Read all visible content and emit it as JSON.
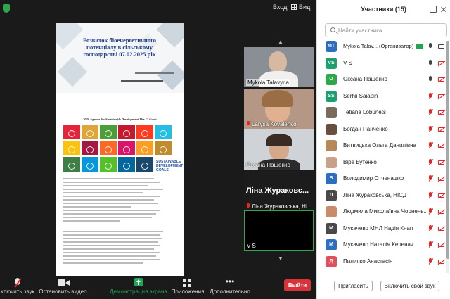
{
  "top": {
    "signin_label": "Вход",
    "view_label": "Вид"
  },
  "document": {
    "title": "Розвиток біоенергетичного потенціалу в сільському господарстві 07.02.2025 рік",
    "sdg_title": "2030 Agenda for Sustainable Development The 17 Goals",
    "goals_label": "SUSTAINABLE DEVELOPMENT GOALS",
    "sdg_colors": [
      "#e5243b",
      "#dda63a",
      "#4c9f38",
      "#c5192d",
      "#ff3a21",
      "#26bde2",
      "#fcc30b",
      "#a21942",
      "#fd6925",
      "#dd1367",
      "#fd9d24",
      "#bf8b2e",
      "#3f7e44",
      "#0a97d9",
      "#56c02b",
      "#00689d",
      "#19486a"
    ]
  },
  "videos": [
    {
      "name": "Mykola Talavyria",
      "muted": false
    },
    {
      "name": "Larysa Kovalenko",
      "muted": true
    },
    {
      "name": "Оксана Пащенко",
      "muted": false
    },
    {
      "name": "Ліна Жураковська, НІ...",
      "big_name": "Ліна Жураковс...",
      "muted": true
    },
    {
      "name": "V S",
      "muted": false
    }
  ],
  "toolbar": {
    "mute_label": "ключить звук",
    "video_label": "Остановить видео",
    "share_label": "Демонстрация экрана",
    "apps_label": "Приложения",
    "more_label": "Дополнительно",
    "leave_label": "Выйти",
    "share_color": "#23a455",
    "leave_color": "#d9333a"
  },
  "panel": {
    "title": "Участники (15)",
    "search_placeholder": "Найти участника",
    "invite_label": "Пригласить",
    "unmute_label": "Включить свой звук",
    "participants": [
      {
        "initials": "MT",
        "name": "Mykola Talav... (Организатор)",
        "color": "#2c6ebf",
        "mic": "on",
        "cam": "on",
        "sharing": true
      },
      {
        "initials": "VS",
        "name": "V S",
        "color": "#1f9e6e",
        "mic": "on",
        "cam": "off"
      },
      {
        "initials": "О",
        "name": "Оксана Пащенко",
        "color": "#2ea84a",
        "mic": "on",
        "cam": "off"
      },
      {
        "initials": "SS",
        "name": "Serhii Saiapin",
        "color": "#1f9e6e",
        "mic": "off",
        "cam": "off"
      },
      {
        "initials": "",
        "name": "Tetiana Lobunets",
        "color": "#7a6a5c",
        "mic": "off",
        "cam": "off"
      },
      {
        "initials": "",
        "name": "Богдан Панченко",
        "color": "#6b4f3e",
        "mic": "off",
        "cam": "off"
      },
      {
        "initials": "",
        "name": "Витвицька Ольга Данилівна",
        "color": "#b8875a",
        "mic": "off",
        "cam": "off"
      },
      {
        "initials": "",
        "name": "Віра Бутенко",
        "color": "#c9a08a",
        "mic": "off",
        "cam": "off"
      },
      {
        "initials": "В",
        "name": "Володимир Отченашко",
        "color": "#2c6ebf",
        "mic": "off",
        "cam": "off"
      },
      {
        "initials": "Л",
        "name": "Ліна Жураковська, НІСД",
        "color": "#4a4a4a",
        "mic": "off",
        "cam": "off"
      },
      {
        "initials": "",
        "name": "Людмила Миколаївна Чорнень...",
        "color": "#c98b6a",
        "mic": "off",
        "cam": "off"
      },
      {
        "initials": "М",
        "name": "Мукачево МНЛ Надія Кнап",
        "color": "#4a4a4a",
        "mic": "off",
        "cam": "off"
      },
      {
        "initials": "М",
        "name": "Мукачево Наталія Кепенач",
        "color": "#2c6ebf",
        "mic": "off",
        "cam": "off"
      },
      {
        "initials": "Д",
        "name": "Пилипко Анастасія",
        "color": "#e0505a",
        "mic": "off",
        "cam": "off"
      }
    ]
  }
}
